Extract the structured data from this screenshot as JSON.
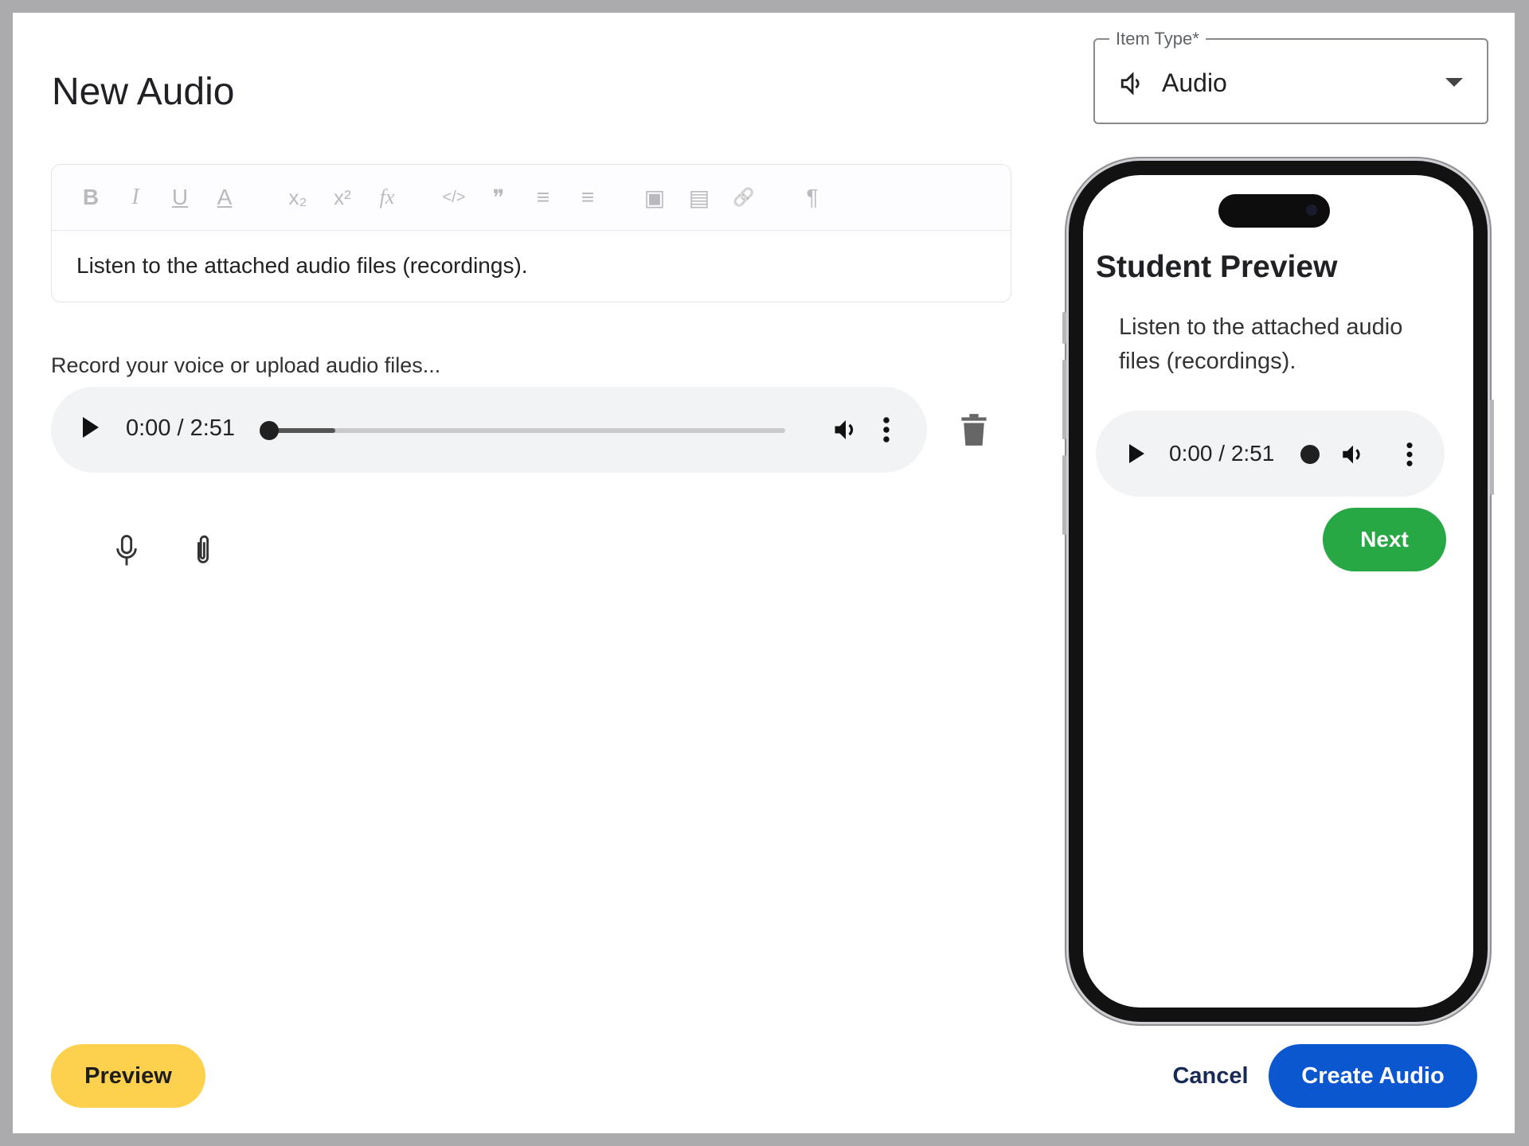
{
  "dialog": {
    "title": "New Audio"
  },
  "item_type": {
    "label": "Item Type*",
    "value": "Audio",
    "icon": "speaker-icon"
  },
  "editor": {
    "toolbar": [
      {
        "name": "bold",
        "glyph": "B"
      },
      {
        "name": "italic",
        "glyph": "I"
      },
      {
        "name": "underline",
        "glyph": "U"
      },
      {
        "name": "text-color",
        "glyph": "A"
      },
      {
        "name": "subscript",
        "glyph": "x₂"
      },
      {
        "name": "superscript",
        "glyph": "x²"
      },
      {
        "name": "formula",
        "glyph": "fx"
      },
      {
        "name": "code",
        "glyph": "</>"
      },
      {
        "name": "blockquote",
        "glyph": "❞"
      },
      {
        "name": "ordered-list",
        "glyph": "≡"
      },
      {
        "name": "bullet-list",
        "glyph": "≡"
      },
      {
        "name": "image",
        "glyph": "▣"
      },
      {
        "name": "video",
        "glyph": "▤"
      },
      {
        "name": "link",
        "glyph": "🔗"
      },
      {
        "name": "text-direction",
        "glyph": "¶"
      }
    ],
    "content": "Listen to the attached audio files (recordings)."
  },
  "audio": {
    "hint": "Record your voice or upload audio files...",
    "time": "0:00 / 2:51",
    "buffered_fraction": 0.13
  },
  "preview": {
    "title": "Student Preview",
    "text": "Listen to the attached audio files (recordings).",
    "time": "0:00 / 2:51",
    "next_label": "Next"
  },
  "footer": {
    "preview_label": "Preview",
    "cancel_label": "Cancel",
    "create_label": "Create Audio"
  },
  "colors": {
    "preview_button": "#fdd14d",
    "create_button": "#0b57d0",
    "next_button": "#28a745"
  }
}
